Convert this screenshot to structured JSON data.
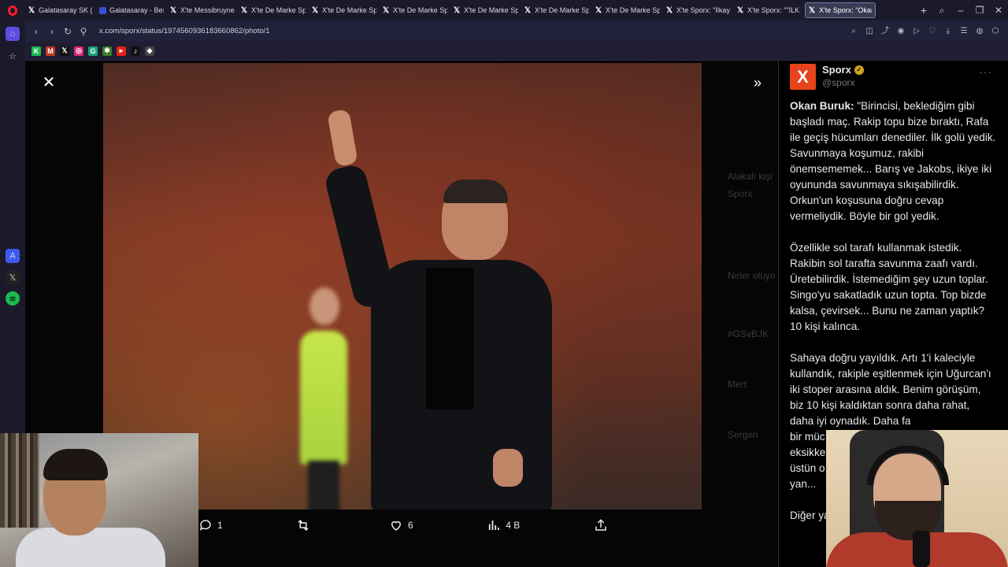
{
  "browser": {
    "tabs": [
      {
        "icon": "x-icon",
        "label": "Galatasaray SK (@G"
      },
      {
        "icon": "gs-icon",
        "label": "Galatasaray - Beşikt"
      },
      {
        "icon": "x-icon",
        "label": "X'te Messibruyne: \""
      },
      {
        "icon": "x-icon",
        "label": "X'te De Marke Spor"
      },
      {
        "icon": "x-icon",
        "label": "X'te De Marke Spor"
      },
      {
        "icon": "x-icon",
        "label": "X'te De Marke Spor"
      },
      {
        "icon": "x-icon",
        "label": "X'te De Marke Spor"
      },
      {
        "icon": "x-icon",
        "label": "X'te De Marke Spor"
      },
      {
        "icon": "x-icon",
        "label": "X'te De Marke Spor"
      },
      {
        "icon": "x-icon",
        "label": "X'te Sporx: \"İlkay Gü"
      },
      {
        "icon": "x-icon",
        "label": "X'te Sporx: \"\"İLK 30"
      },
      {
        "icon": "x-icon",
        "label": "X'te Sporx: \"Okan Buruk:",
        "active": true
      }
    ],
    "new_tab": "+",
    "url": "x.com/sporx/status/1974560936183660862/photo/1"
  },
  "viewer": {
    "actions": {
      "replies": "1",
      "reposts": "",
      "likes": "6",
      "views": "4 B"
    },
    "ghost": [
      "Alakalı kişi",
      "Sporx",
      "Neler oluyo",
      "#GSvBJK",
      "Mert",
      "Sergen"
    ]
  },
  "tweet": {
    "author_name": "Sporx",
    "author_handle": "@sporx",
    "avatar_letter": "X",
    "body": {
      "speaker": "Okan Buruk:",
      "p1": " \"Birincisi, beklediğim gibi başladı maç. Rakip topu bize bıraktı, Rafa ile geçiş hücumları denediler. İlk golü yedik. Savunmaya koşumuz, rakibi önemsememek... Barış ve Jakobs, ikiye iki oyununda savunmaya sıkışabilirdik. Orkun'un koşusuna doğru cevap vermeliydik. Böyle bir gol yedik.",
      "p2": "Özellikle sol tarafı kullanmak istedik. Rakibin sol tarafta savunma zaafı vardı. Üretebilirdik. İstemediğim şey uzun toplar. Singo'yu sakatladık uzun topta. Top bizde kalsa, çevirsek... Bunu ne zaman yaptık? 10 kişi kalınca.",
      "p3": "Sahaya doğru yayıldık. Artı 1'i kaleciyle kullandık, rakiple eşitlenmek için Uğurcan'ı iki stoper arasına aldık. Benim görüşüm, biz 10 kişi kaldıktan sonra daha rahat, daha iyi oynadık. Daha fa",
      "p3b": "bir müc",
      "p3c": "eksikke",
      "p3d": "üstün o",
      "p3e": "yan...",
      "p4": "Diğer ya"
    }
  }
}
